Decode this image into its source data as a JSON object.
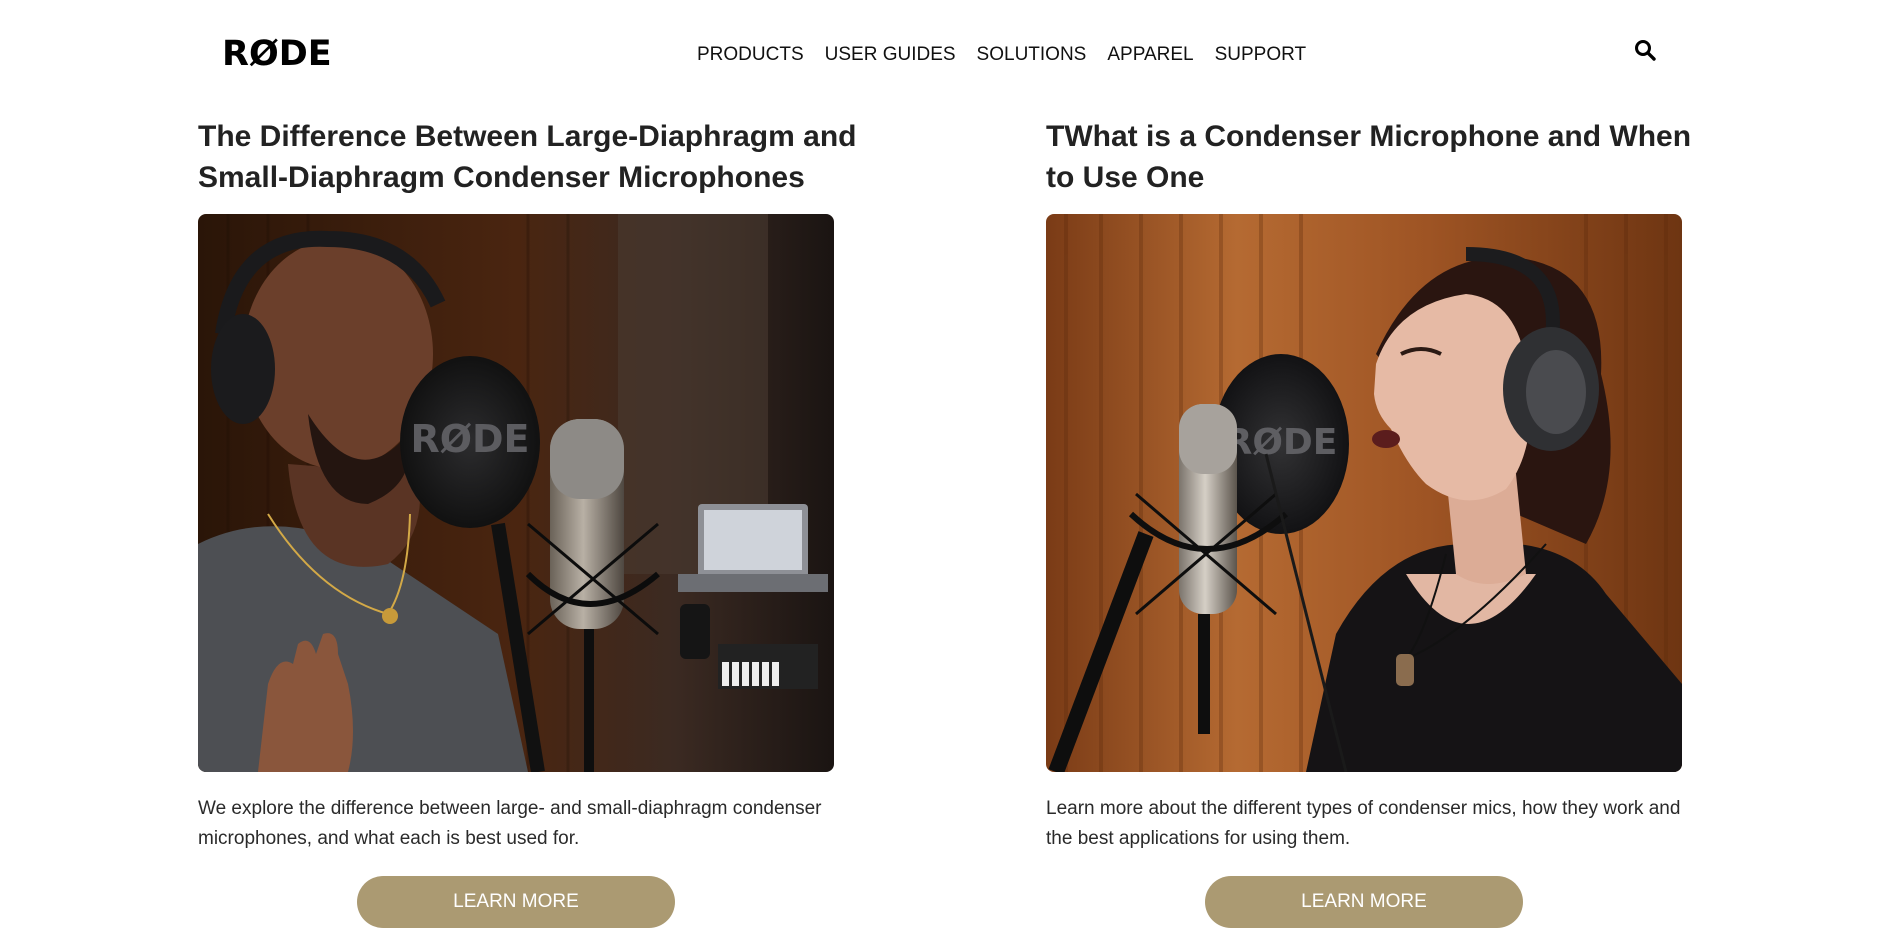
{
  "header": {
    "logo": "RØDE",
    "nav": [
      "PRODUCTS",
      "USER GUIDES",
      "SOLUTIONS",
      "APPAREL",
      "SUPPORT"
    ],
    "search_icon": "search-icon"
  },
  "cards": [
    {
      "title": "The Difference Between Large-Diaphragm and Small-Diaphragm Condenser Microphones",
      "description": "We explore the difference between large- and small-diaphragm condenser microphones, and what each is best used for.",
      "button": "LEARN MORE",
      "image_alt": "Man singing into a RØDE condenser microphone with pop filter",
      "pop_filter_text": "RØDE"
    },
    {
      "title": "TWhat is a Condenser Microphone and When to Use One",
      "description": "Learn more about the different types of condenser mics, how they work and the best applications for using them.",
      "button": "LEARN MORE",
      "image_alt": "Woman singing into a RØDE condenser microphone in a studio",
      "pop_filter_text": "RØDE"
    }
  ],
  "colors": {
    "button": "#ab9a72",
    "text": "#222222",
    "background": "#ffffff"
  }
}
